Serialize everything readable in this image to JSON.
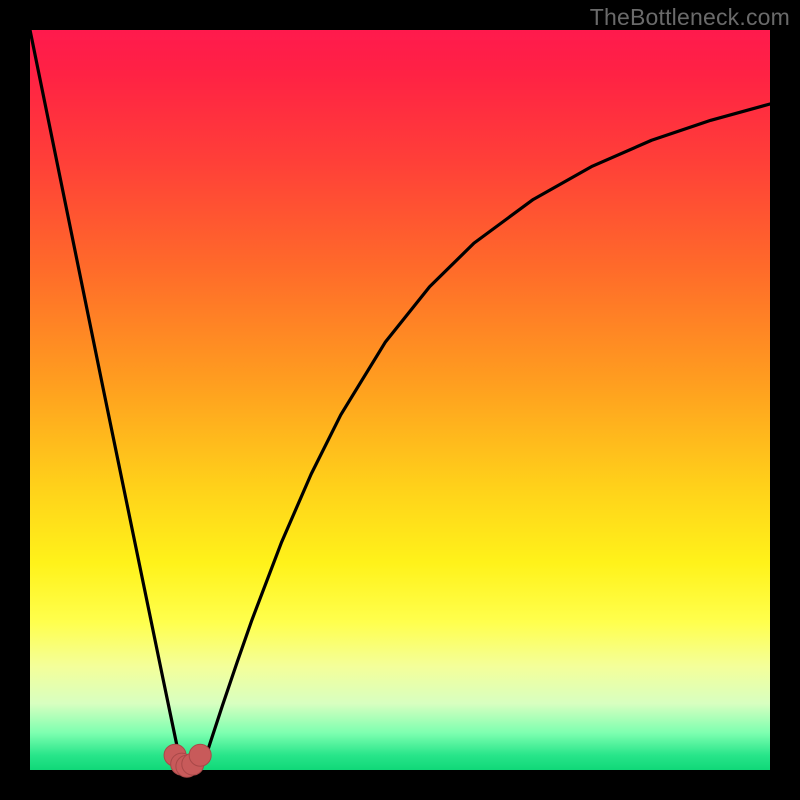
{
  "watermark": {
    "text": "TheBottleneck.com"
  },
  "chart_data": {
    "type": "line",
    "title": "",
    "xlabel": "",
    "ylabel": "",
    "xlim": [
      0,
      100
    ],
    "ylim": [
      0,
      100
    ],
    "grid": false,
    "legend": false,
    "series": [
      {
        "name": "curve",
        "x": [
          0,
          2,
          4,
          6,
          8,
          10,
          12,
          14,
          16,
          18,
          19,
          20,
          21,
          22,
          23,
          24,
          26,
          28,
          30,
          34,
          38,
          42,
          48,
          54,
          60,
          68,
          76,
          84,
          92,
          100
        ],
        "y": [
          100,
          90.2,
          80.4,
          70.6,
          60.8,
          51.0,
          41.3,
          31.6,
          21.9,
          12.2,
          7.4,
          2.6,
          0.9,
          0.4,
          0.9,
          2.6,
          8.7,
          14.6,
          20.3,
          30.8,
          40.0,
          48.0,
          57.8,
          65.3,
          71.2,
          77.1,
          81.6,
          85.1,
          87.8,
          90.0
        ]
      }
    ],
    "markers": [
      {
        "x": 19.6,
        "y": 2.0
      },
      {
        "x": 20.5,
        "y": 0.8
      },
      {
        "x": 21.2,
        "y": 0.5
      },
      {
        "x": 22.0,
        "y": 0.8
      },
      {
        "x": 23.0,
        "y": 2.0
      }
    ],
    "colors": {
      "curve": "#000000",
      "marker_fill": "#c85a5a",
      "marker_stroke": "#a84848"
    }
  }
}
